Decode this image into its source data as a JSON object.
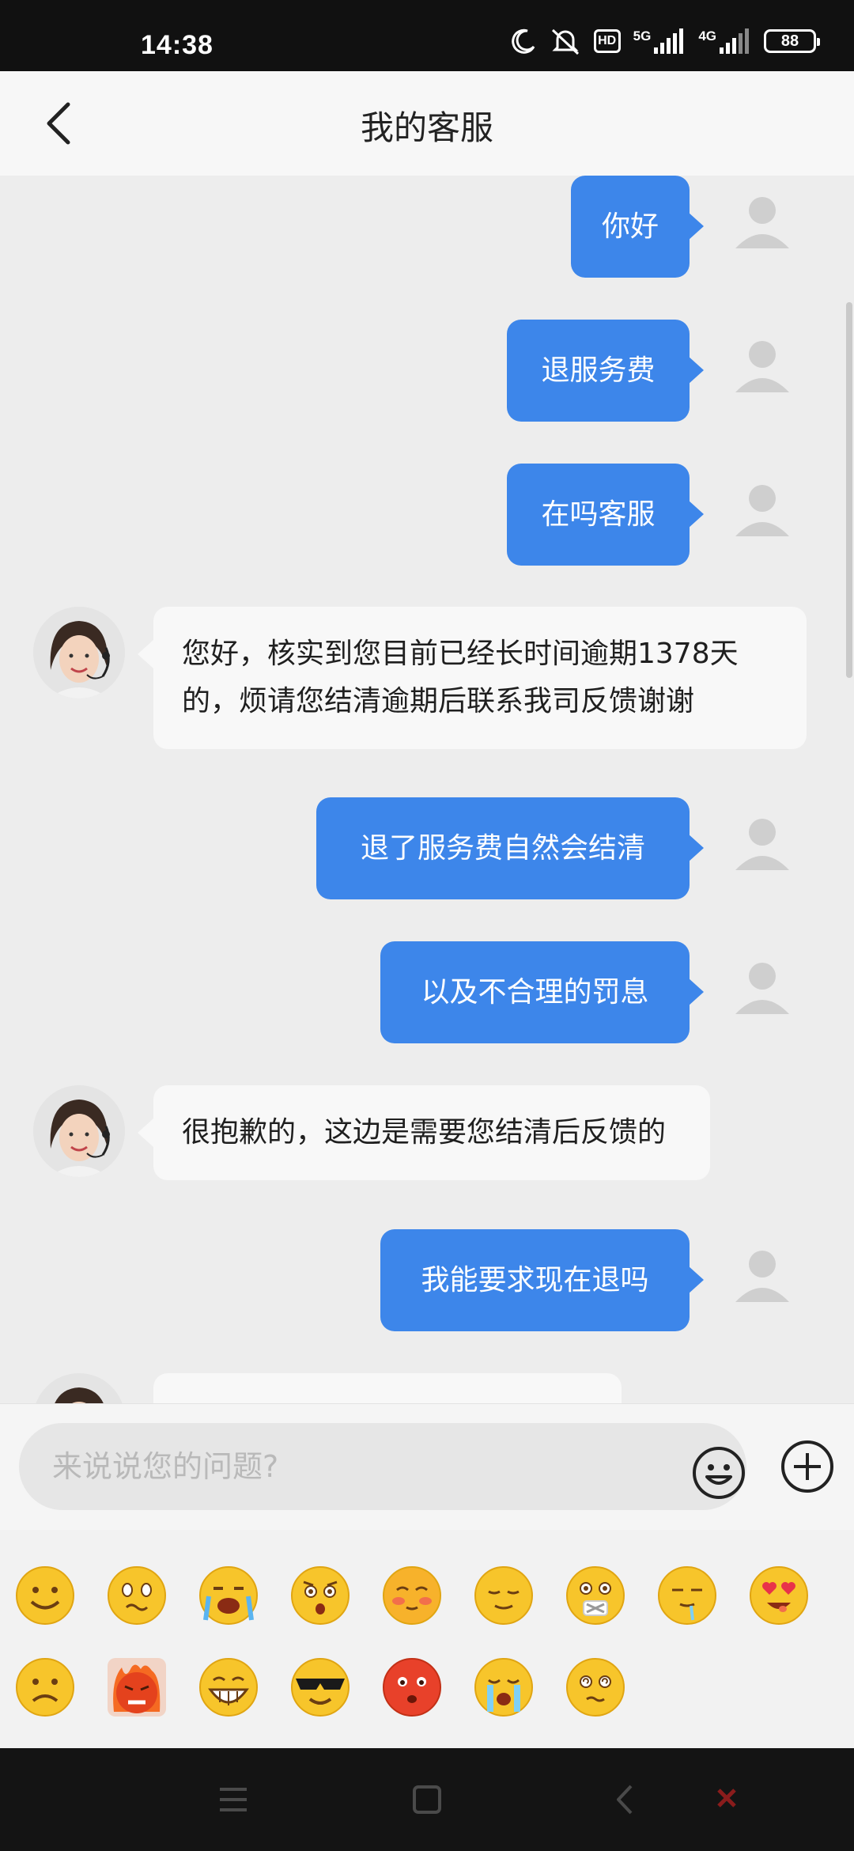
{
  "status_bar": {
    "time": "14:38",
    "hd": "HD",
    "net1": "5G",
    "net2": "4G",
    "battery": "88"
  },
  "header": {
    "title": "我的客服"
  },
  "messages": [
    {
      "side": "out",
      "text": "你好"
    },
    {
      "side": "out",
      "text": "退服务费"
    },
    {
      "side": "out",
      "text": "在吗客服"
    },
    {
      "side": "in",
      "text": "您好，核实到您目前已经长时间逾期1378天的，烦请您结清逾期后联系我司反馈谢谢"
    },
    {
      "side": "out",
      "text": "退了服务费自然会结清"
    },
    {
      "side": "out",
      "text": "以及不合理的罚息"
    },
    {
      "side": "in",
      "text": "很抱歉的，这边是需要您结清后反馈的"
    },
    {
      "side": "out",
      "text": "我能要求现在退吗"
    }
  ],
  "input": {
    "placeholder": "来说说您的问题?"
  },
  "emoji_panel": {
    "emojis": [
      "smile",
      "nervous",
      "crying-loud",
      "shocked",
      "shy",
      "content",
      "muted",
      "drooling",
      "heart-eyes",
      "frown",
      "angry",
      "grin",
      "cool",
      "blush-red",
      "sob",
      "dizzy"
    ]
  },
  "colors": {
    "bubble_out": "#3d86ea",
    "bubble_in": "#f8f8f8",
    "background": "#ededed"
  }
}
